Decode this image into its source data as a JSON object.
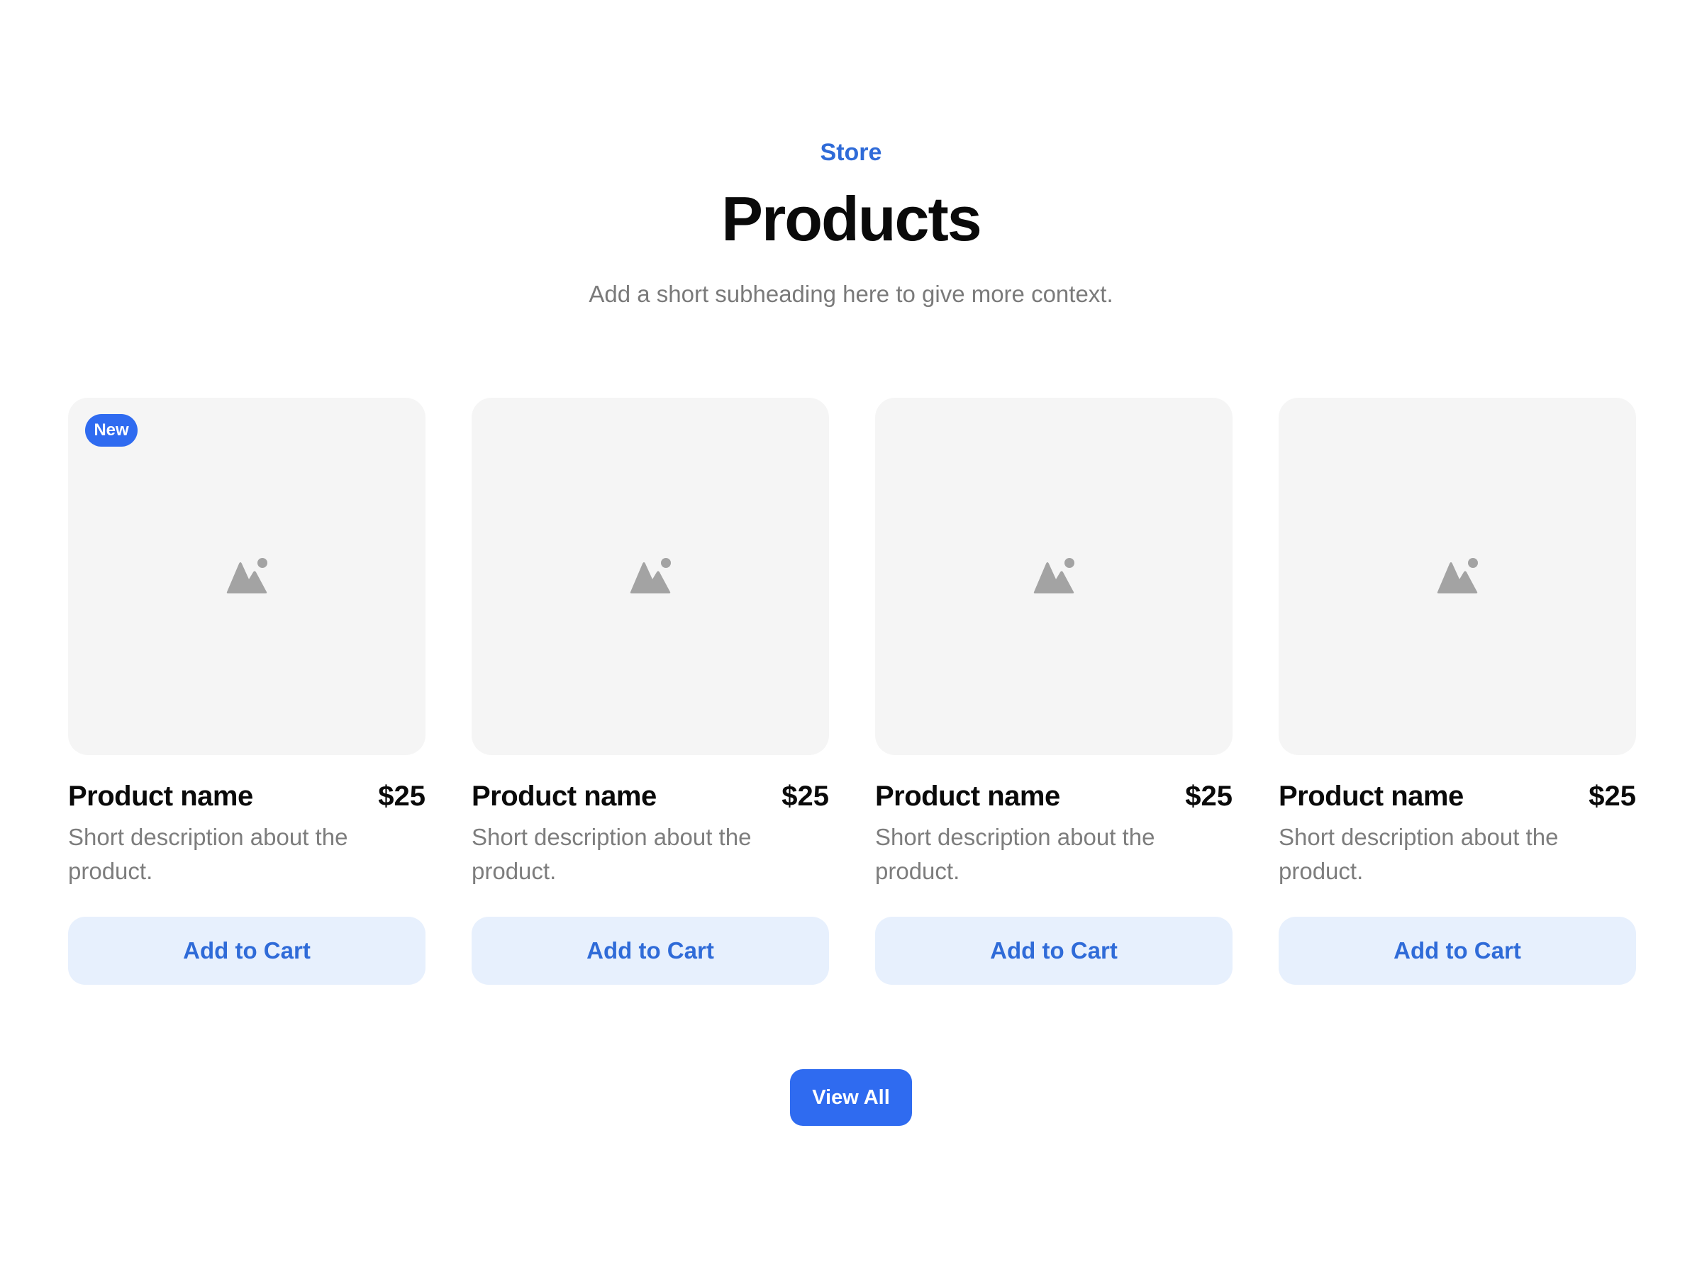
{
  "header": {
    "eyebrow": "Store",
    "title": "Products",
    "subtitle": "Add a short subheading here to give more context."
  },
  "products": [
    {
      "badge": "New",
      "name": "Product name",
      "price": "$25",
      "description": "Short description about the product.",
      "cta": "Add to Cart",
      "image_icon": "image-placeholder-icon"
    },
    {
      "badge": "",
      "name": "Product name",
      "price": "$25",
      "description": "Short description about the product.",
      "cta": "Add to Cart",
      "image_icon": "image-placeholder-icon"
    },
    {
      "badge": "",
      "name": "Product name",
      "price": "$25",
      "description": "Short description about the product.",
      "cta": "Add to Cart",
      "image_icon": "image-placeholder-icon"
    },
    {
      "badge": "",
      "name": "Product name",
      "price": "$25",
      "description": "Short description about the product.",
      "cta": "Add to Cart",
      "image_icon": "image-placeholder-icon"
    }
  ],
  "footer": {
    "view_all_label": "View All"
  },
  "colors": {
    "accent": "#2f6bf0",
    "accent_text": "#2f6bd8",
    "button_tint": "#e7f0fd",
    "image_bg": "#f5f5f5",
    "muted_text": "#7a7a7a"
  }
}
